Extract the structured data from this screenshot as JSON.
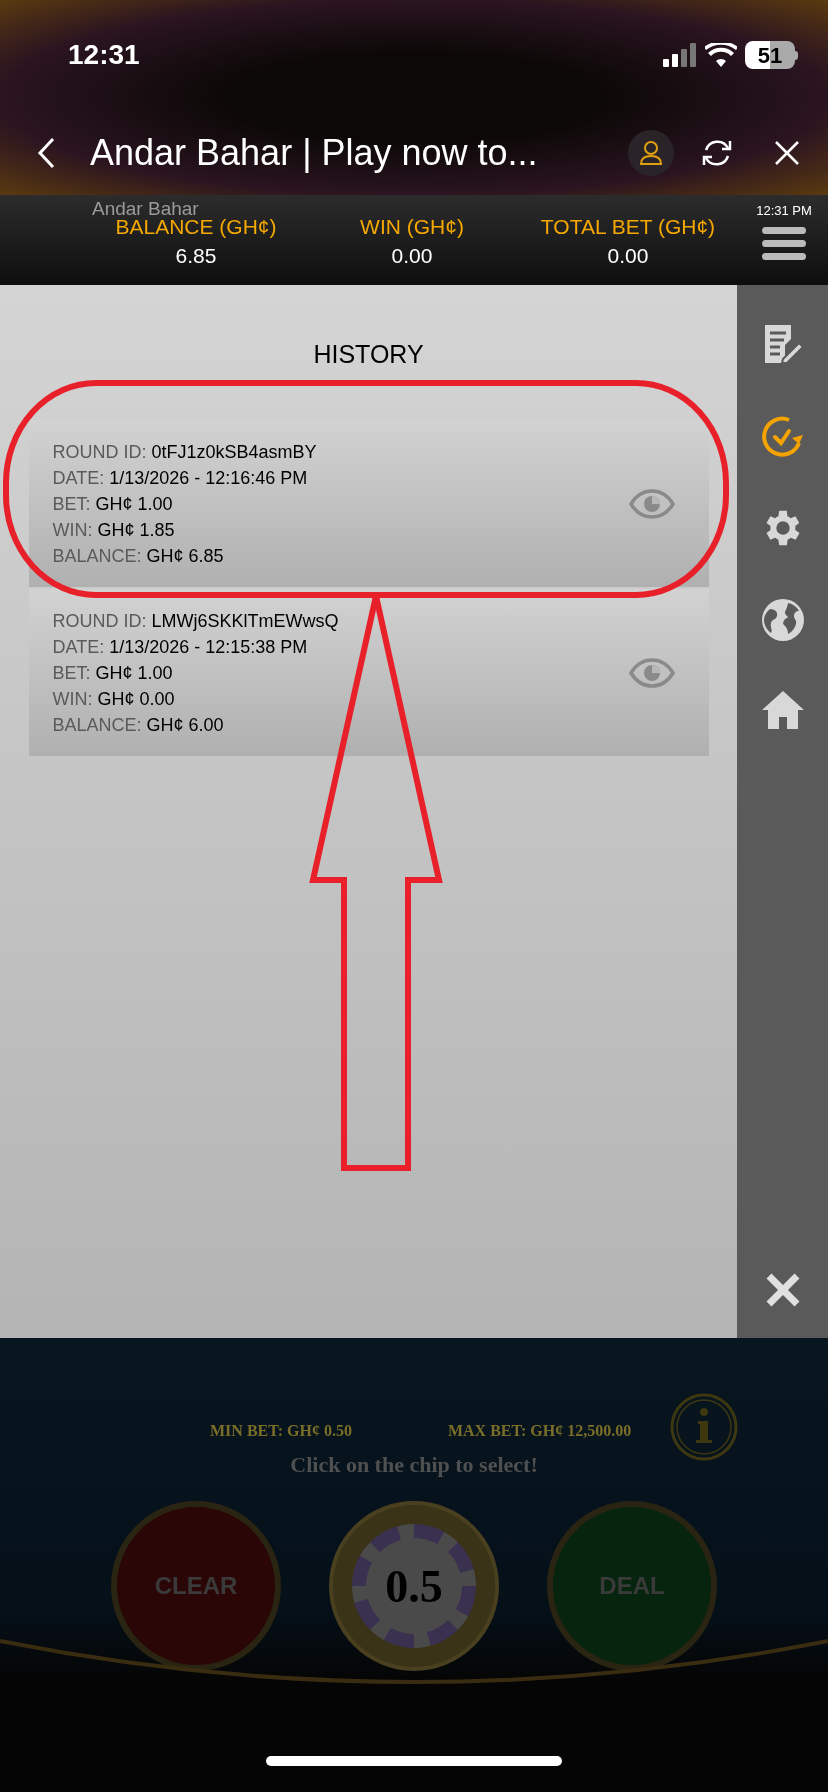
{
  "status_bar": {
    "time": "12:31",
    "battery": "51"
  },
  "browser_bar": {
    "title": "Andar Bahar | Play now to..."
  },
  "game_bar": {
    "game_name": "Andar Bahar",
    "clock": "12:31 PM",
    "stats": [
      {
        "label": "BALANCE (GH¢)",
        "value": "6.85"
      },
      {
        "label": "WIN (GH¢)",
        "value": "0.00"
      },
      {
        "label": "TOTAL BET (GH¢)",
        "value": "0.00"
      }
    ]
  },
  "history": {
    "title": "HISTORY",
    "rounds": [
      {
        "highlighted": true,
        "fields": [
          {
            "label": "ROUND ID:",
            "value": "0tFJ1z0kSB4asmBY"
          },
          {
            "label": "DATE:",
            "value": "1/13/2026 - 12:16:46 PM"
          },
          {
            "label": "BET:",
            "value": "GH¢ 1.00"
          },
          {
            "label": "WIN:",
            "value": "GH¢ 1.85"
          },
          {
            "label": "BALANCE:",
            "value": "GH¢ 6.85"
          }
        ]
      },
      {
        "highlighted": false,
        "fields": [
          {
            "label": "ROUND ID:",
            "value": "LMWj6SKKlTmEWwsQ"
          },
          {
            "label": "DATE:",
            "value": "1/13/2026 - 12:15:38 PM"
          },
          {
            "label": "BET:",
            "value": "GH¢ 1.00"
          },
          {
            "label": "WIN:",
            "value": "GH¢ 0.00"
          },
          {
            "label": "BALANCE:",
            "value": "GH¢ 6.00"
          }
        ]
      }
    ]
  },
  "sidebar": {
    "items": [
      {
        "kind": "notes",
        "selected": false
      },
      {
        "kind": "history",
        "selected": true
      },
      {
        "kind": "settings",
        "selected": false
      },
      {
        "kind": "language",
        "selected": false
      },
      {
        "kind": "home",
        "selected": false
      }
    ]
  },
  "game_table": {
    "min_bet": "MIN BET: GH¢ 0.50",
    "max_bet": "MAX BET: GH¢ 12,500.00",
    "hint": "Click on the chip to select!",
    "buttons": [
      {
        "kind": "clear",
        "label": "CLEAR"
      },
      {
        "kind": "chip",
        "label": "0.5"
      },
      {
        "kind": "deal",
        "label": "DEAL"
      }
    ]
  }
}
